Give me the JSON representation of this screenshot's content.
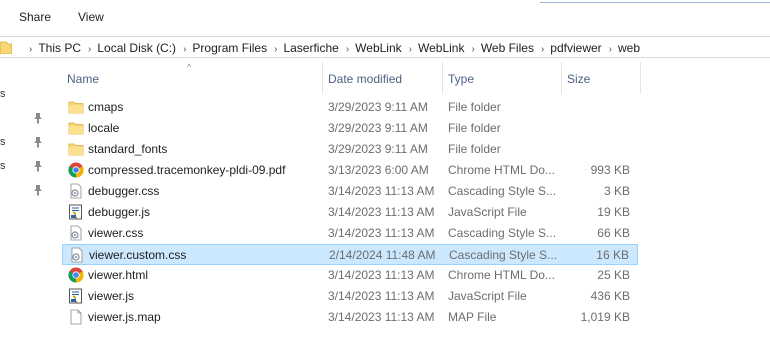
{
  "ribbon": {
    "share_label": "Share",
    "view_label": "View"
  },
  "address": {
    "crumbs": [
      "This PC",
      "Local Disk (C:)",
      "Program Files",
      "Laserfiche",
      "WebLink",
      "WebLink",
      "Web Files",
      "pdfviewer",
      "web"
    ]
  },
  "nav": {
    "fragments": [
      "s",
      "s",
      "s"
    ]
  },
  "columns": {
    "name": "Name",
    "date": "Date modified",
    "type": "Type",
    "size": "Size"
  },
  "files": [
    {
      "icon": "folder-icon",
      "name": "cmaps",
      "date": "3/29/2023 9:11 AM",
      "type": "File folder",
      "size": ""
    },
    {
      "icon": "folder-icon",
      "name": "locale",
      "date": "3/29/2023 9:11 AM",
      "type": "File folder",
      "size": ""
    },
    {
      "icon": "folder-icon",
      "name": "standard_fonts",
      "date": "3/29/2023 9:11 AM",
      "type": "File folder",
      "size": ""
    },
    {
      "icon": "chrome-icon",
      "name": "compressed.tracemonkey-pldi-09.pdf",
      "date": "3/13/2023 6:00 AM",
      "type": "Chrome HTML Do...",
      "size": "993 KB"
    },
    {
      "icon": "css-file-icon",
      "name": "debugger.css",
      "date": "3/14/2023 11:13 AM",
      "type": "Cascading Style S...",
      "size": "3 KB"
    },
    {
      "icon": "js-file-icon",
      "name": "debugger.js",
      "date": "3/14/2023 11:13 AM",
      "type": "JavaScript File",
      "size": "19 KB"
    },
    {
      "icon": "css-file-icon",
      "name": "viewer.css",
      "date": "3/14/2023 11:13 AM",
      "type": "Cascading Style S...",
      "size": "66 KB"
    },
    {
      "icon": "css-file-icon",
      "name": "viewer.custom.css",
      "date": "2/14/2024 11:48 AM",
      "type": "Cascading Style S...",
      "size": "16 KB",
      "selected": true
    },
    {
      "icon": "chrome-icon",
      "name": "viewer.html",
      "date": "3/14/2023 11:13 AM",
      "type": "Chrome HTML Do...",
      "size": "25 KB"
    },
    {
      "icon": "js-file-icon",
      "name": "viewer.js",
      "date": "3/14/2023 11:13 AM",
      "type": "JavaScript File",
      "size": "436 KB"
    },
    {
      "icon": "generic-file-icon",
      "name": "viewer.js.map",
      "date": "3/14/2023 11:13 AM",
      "type": "MAP File",
      "size": "1,019 KB"
    }
  ]
}
